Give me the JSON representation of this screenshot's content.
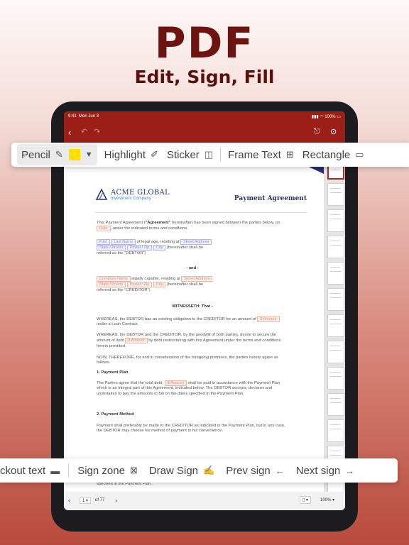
{
  "hero": {
    "title": "PDF",
    "subtitle": "Edit, Sign, Fill"
  },
  "status": {
    "time": "9:41",
    "date": "Mon Jun 3",
    "battery": "100%"
  },
  "toolbar": {
    "pencil": "Pencil",
    "pencil_color": "#ffe000",
    "highlight": "Highlight",
    "sticker": "Sticker",
    "frame_text": "Frame Text",
    "rectangle": "Rectangle"
  },
  "signbar": {
    "checkout_text": "ckout text",
    "sign_zone": "Sign zone",
    "draw_sign": "Draw Sign",
    "prev_sign": "Prev sign",
    "next_sign": "Next sign"
  },
  "doc": {
    "company": "ACME GLOBAL",
    "company_tag": "Investment Company",
    "title": "Payment Agreement",
    "p1a": "This Payment Agreement (",
    "p1b": "\"Agreement\"",
    "p1c": " hereinafter) has been signed between the parties below, on",
    "p1d": ", under the indicated terms and conditions.",
    "f_date": "Date",
    "f_first": "First",
    "f_last": "Last Name",
    "of_legal": "of legal age, residing at",
    "f_street": "Street Address",
    "f_state": "State / Provin",
    "f_postal": "Postal / Zip",
    "f_city": "City",
    "hereinafter": "(hereinafter shall be",
    "referred_debtor": "referred as the \"DEBTOR\")",
    "and": "- and -",
    "f_company": "Company Name",
    "legally": "legally capable, residing at",
    "referred_creditor": "referred as the \"CREDITOR\")",
    "witnesseth": "WITNESSETH: That -",
    "w1": "WHEREAS, the DEBTOR has an existing obligation to the CREDITOR for an amount of",
    "f_amount": "$ Amount",
    "w1b": "under a Loan Contract.",
    "w2": "WHEREAS, the DEBTOR and the CREDITOR, by the goodwill of both parties, desire to secure the amount of debt",
    "w2b": "by debt restructuring with this Agreement under the terms and conditions herein provided.",
    "w3": "NOW, THEREFORE, for and in consideration of the foregoing premises, the parties hereto agree as follows.",
    "h1": "1. Payment Plan",
    "pp1": "The Parties agree that the total debt,",
    "pp2": "shall be paid in accordance with the Payment Plan which is an integral part of this Agreement, indicated below. The DEBTOR accepts, declares and undertakes to pay the amounts in full on the dates specified in the Payment Plan.",
    "h2": "2. Payment Method",
    "pm": "Payment shall preferably be made to the CREDITOR as indicated in the Payment Plan, but in any case, the DEBTOR may choose his method of payment to his convenience.",
    "tail": "specified in the Payment Plan."
  },
  "pager": {
    "page": "1",
    "of": "of 77",
    "zoom": "100%"
  }
}
